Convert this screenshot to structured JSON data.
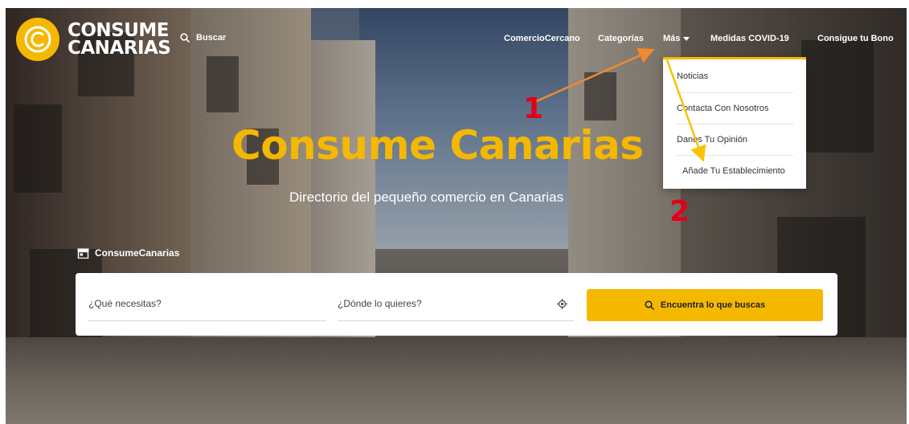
{
  "brand": {
    "line1": "CONSUME",
    "line2": "CANARIAS",
    "icon": "circle-logo-icon"
  },
  "header": {
    "search_label": "Buscar",
    "nav": {
      "comercio": "ComercioCercano",
      "categorias": "Categorías",
      "mas": "Más",
      "covid": "Medidas COVID-19",
      "bono": "Consigue tu Bono"
    }
  },
  "dropdown": {
    "items": [
      "Noticias",
      "Contacta Con Nosotros",
      "Danos Tu Opinión",
      "Añade Tu Establecimiento"
    ]
  },
  "hero": {
    "title": "Consume Canarias",
    "subtitle": "Directorio del pequeño comercio en Canarias"
  },
  "brand_line": {
    "label": "ConsumeCanarias",
    "icon": "store-icon"
  },
  "search": {
    "what_placeholder": "¿Qué necesitas?",
    "where_placeholder": "¿Dónde lo quieres?",
    "button_label": "Encuentra lo que buscas"
  },
  "annotations": {
    "step1": "1",
    "step2": "2",
    "arrow1_color": "#f08a2e",
    "arrow2_color": "#f5c400"
  },
  "colors": {
    "accent": "#f5b800",
    "annotation_red": "#e3001b"
  }
}
